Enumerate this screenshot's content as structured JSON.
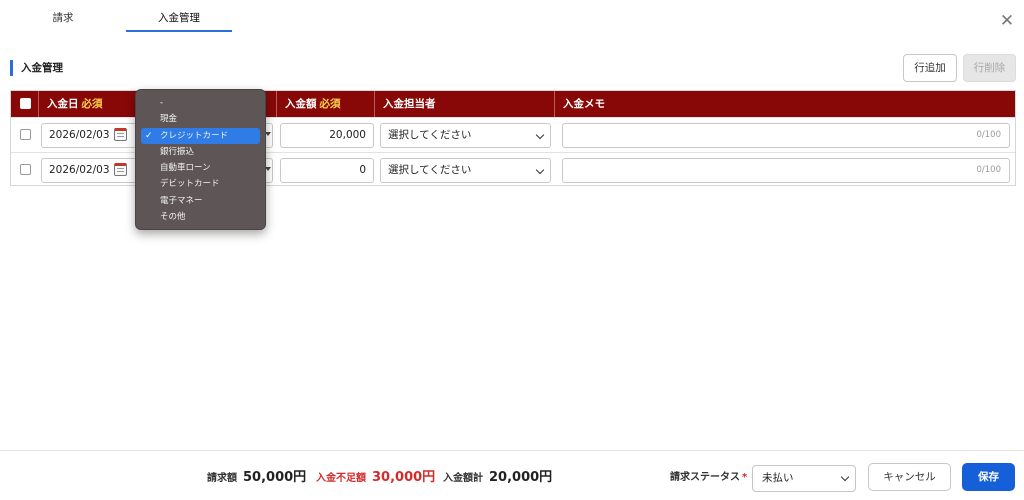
{
  "tabs": [
    {
      "label": "請求"
    },
    {
      "label": "入金管理"
    }
  ],
  "section": {
    "title": "入金管理"
  },
  "toolbar": {
    "add_row": "行追加",
    "delete_row": "行削除"
  },
  "table": {
    "columns": {
      "date": "入金日",
      "date_required": "必須",
      "amount": "入金額",
      "amount_required": "必須",
      "person": "入金担当者",
      "memo": "入金メモ"
    },
    "rows": [
      {
        "date": "2026/02/03",
        "amount": "20,000",
        "person": "選択してください",
        "memo_count": "0/100"
      },
      {
        "date": "2026/02/03",
        "amount": "0",
        "person": "選択してください",
        "memo_count": "0/100"
      }
    ]
  },
  "method_dropdown": {
    "options": [
      "-",
      "現金",
      "クレジットカード",
      "銀行振込",
      "自動車ローン",
      "デビットカード",
      "電子マネー",
      "その他"
    ],
    "selected_index": 2,
    "check_mark": "✓"
  },
  "footer": {
    "invoice_label": "請求額",
    "invoice_value": "50,000円",
    "shortage_label": "入金不足額",
    "shortage_value": "30,000円",
    "total_label": "入金額計",
    "total_value": "20,000円",
    "status_label": "請求ステータス",
    "status_required": "*",
    "status_value": "未払い",
    "cancel": "キャンセル",
    "save": "保存"
  },
  "colors": {
    "header_bg": "#880808",
    "accent": "#2a6fdb",
    "save_button": "#1560d8",
    "shortage": "#d62a2a",
    "required": "#ffd24a"
  },
  "icons": {
    "close": "close-icon",
    "calendar": "calendar-icon",
    "check": "check-icon"
  }
}
